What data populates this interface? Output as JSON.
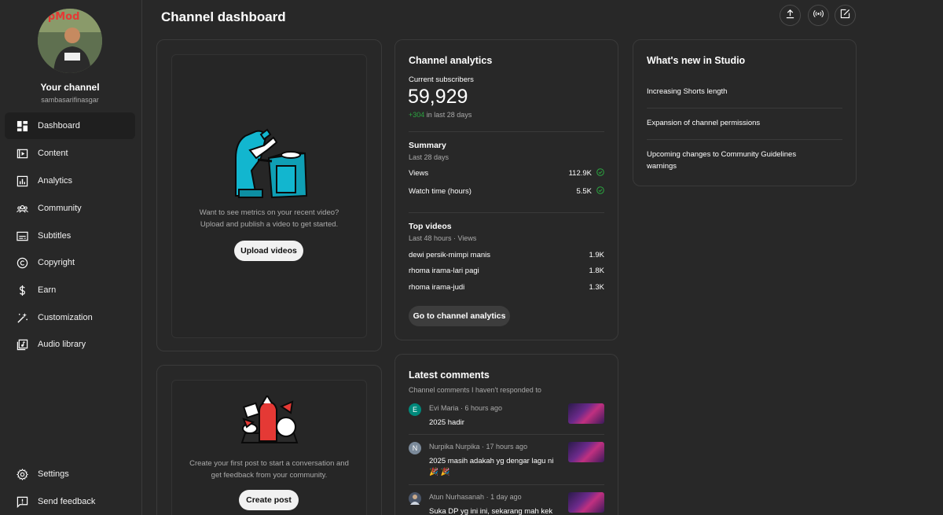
{
  "sidebar": {
    "channel_name": "Your channel",
    "channel_handle": "sambasarifinasgar",
    "avatar_text": "opMod",
    "items": [
      {
        "label": "Dashboard",
        "icon": "dashboard-icon",
        "active": true
      },
      {
        "label": "Content",
        "icon": "content-icon"
      },
      {
        "label": "Analytics",
        "icon": "analytics-icon"
      },
      {
        "label": "Community",
        "icon": "community-icon"
      },
      {
        "label": "Subtitles",
        "icon": "subtitles-icon"
      },
      {
        "label": "Copyright",
        "icon": "copyright-icon"
      },
      {
        "label": "Earn",
        "icon": "dollar-icon"
      },
      {
        "label": "Customization",
        "icon": "magic-wand-icon"
      },
      {
        "label": "Audio library",
        "icon": "audio-library-icon"
      }
    ],
    "bottom_items": [
      {
        "label": "Settings",
        "icon": "gear-icon"
      },
      {
        "label": "Send feedback",
        "icon": "feedback-icon"
      }
    ]
  },
  "header": {
    "title": "Channel dashboard",
    "actions": [
      "upload-icon",
      "live-icon",
      "create-post-icon"
    ]
  },
  "upload_card": {
    "text_line1": "Want to see metrics on your recent video?",
    "text_line2": "Upload and publish a video to get started.",
    "button": "Upload videos"
  },
  "post_card": {
    "text_line1": "Create your first post to start a conversation and",
    "text_line2": "get feedback from your community.",
    "button": "Create post"
  },
  "analytics": {
    "title": "Channel analytics",
    "subs_label": "Current subscribers",
    "subs_value": "59,929",
    "subs_delta": "+304",
    "subs_delta_suffix": " in last 28 days",
    "summary_title": "Summary",
    "summary_period": "Last 28 days",
    "metrics": [
      {
        "label": "Views",
        "value": "112.9K"
      },
      {
        "label": "Watch time (hours)",
        "value": "5.5K"
      }
    ],
    "top_title": "Top videos",
    "top_period": "Last 48 hours · Views",
    "top_videos": [
      {
        "title": "dewi persik-mimpi manis",
        "views": "1.9K"
      },
      {
        "title": "rhoma irama-lari pagi",
        "views": "1.8K"
      },
      {
        "title": "rhoma irama-judi",
        "views": "1.3K"
      }
    ],
    "button": "Go to channel analytics"
  },
  "comments": {
    "title": "Latest comments",
    "subtitle": "Channel comments I haven't responded to",
    "items": [
      {
        "initial": "E",
        "color": "#00897b",
        "author": "Evi Maria",
        "time": "6 hours ago",
        "text": "2025 hadir"
      },
      {
        "initial": "N",
        "color": "#7b8a9a",
        "author": "Nurpika Nurpika",
        "time": "17 hours ago",
        "text": "2025 masih adakah yg dengar lagu ni 🎉 🎉"
      },
      {
        "initial": "",
        "color": "#556",
        "author": "Atun Nurhasanah",
        "time": "1 day ago",
        "text": "Suka DP yg ini ini, sekarang mah kek"
      }
    ]
  },
  "news": {
    "title": "What's new in Studio",
    "items": [
      "Increasing Shorts length",
      "Expansion of channel permissions",
      "Upcoming changes to Community Guidelines warnings"
    ]
  },
  "colors": {
    "accent_green": "#2ba640",
    "background": "#282828",
    "illustration_cyan": "#12b6cf",
    "illustration_red": "#e53935"
  }
}
